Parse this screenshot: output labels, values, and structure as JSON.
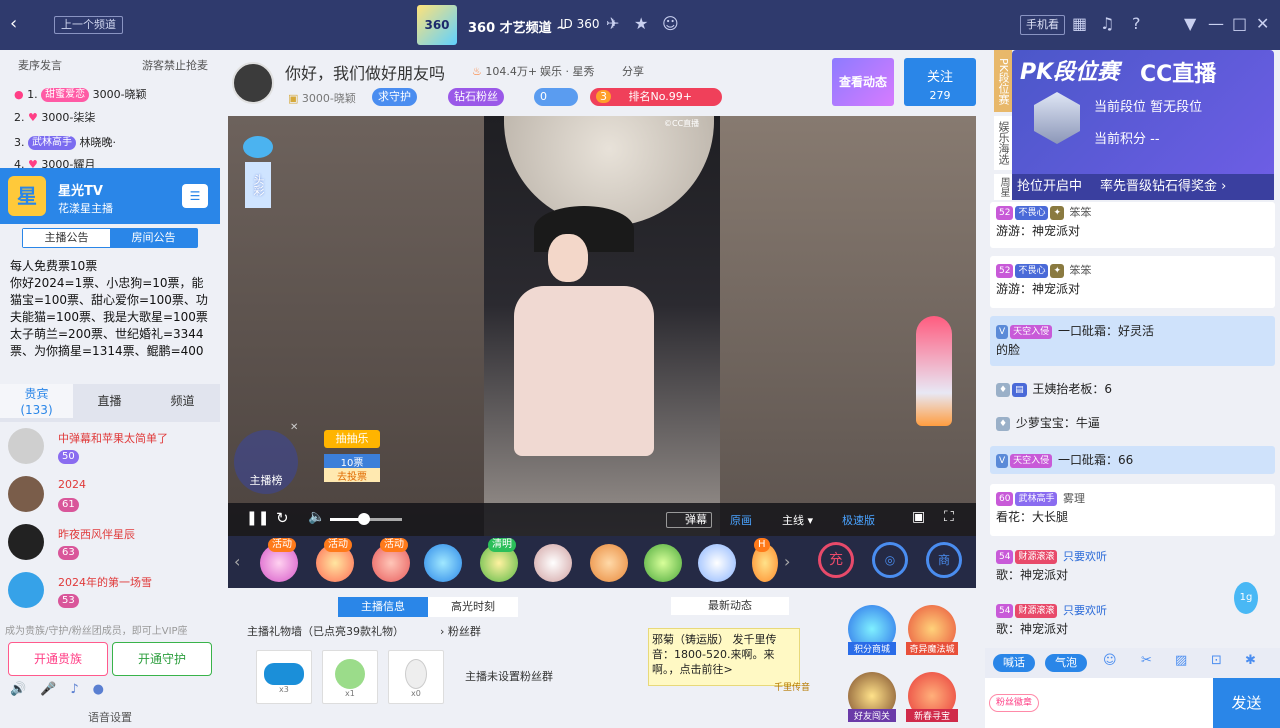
{
  "topbar": {
    "prev_channel": "上一个频道",
    "logo_text": "360",
    "channel_name": "360 才艺频道 ~",
    "channel_id": "ID 360",
    "mobile_watch": "手机看"
  },
  "left": {
    "tabs": {
      "mic_order": "麦序发言",
      "guest_ban": "游客禁止抢麦"
    },
    "rank": [
      {
        "num": "1.",
        "badge": "甜蜜爱恋",
        "name": "3000-晓颖"
      },
      {
        "num": "2.",
        "badge": "",
        "name": "3000-柒柒"
      },
      {
        "num": "3.",
        "badge": "武林高手",
        "name": "林晓晚·"
      },
      {
        "num": "4.",
        "badge": "",
        "name": "3000-耀月"
      }
    ],
    "host_channel": {
      "avatar_text": "星",
      "name": "星光TV",
      "subtitle": "花漾星主播"
    },
    "announce_tabs": {
      "host": "主播公告",
      "room": "房间公告"
    },
    "announcement": "每人免费票10票\n你好2024=1票、小忠狗=10票，能猫宝=100票、甜心爱你=100票、功夫能猫=100票、我是大歌星=100票\n太子萌兰=200票、世纪婚礼=3344票、为你摘星=1314票、鲲鹏=400",
    "vip_tabs": {
      "guests": "贵宾",
      "guests_count": "(133)",
      "live": "直播",
      "channel": "频道"
    },
    "vip_users": [
      {
        "name": "中弹幕和苹果太简单了",
        "level": "50"
      },
      {
        "name": "2024",
        "level": "61"
      },
      {
        "name": "昨夜西风伴星辰",
        "level": "63"
      },
      {
        "name": "2024年的第一场雪",
        "level": "53"
      }
    ],
    "vip_hint": "成为贵族/守护/粉丝团成员，即可上VIP座",
    "open_noble": "开通贵族",
    "open_guard": "开通守护",
    "voice_settings": "语音设置"
  },
  "center": {
    "title": "你好，我们做好朋友吗",
    "popularity": "104.4万+",
    "category": "娱乐 · 星秀",
    "share": "分享",
    "host_name": "3000-晓颖",
    "guard": "求守护",
    "diamond_fans": "钻石粉丝",
    "fans_count": "0",
    "rank_level": "3",
    "rank": "排名No.99+",
    "view_dynamics": "查看动态",
    "follow": "关注",
    "follow_count": "279",
    "video_badge": "头彩",
    "host_list": "主播榜",
    "lottery": "抽抽乐",
    "ticket": "10票",
    "ticket_cta": "去投票",
    "watermark": "©CC直播",
    "danmaku": "弹幕",
    "quality": "原画",
    "line": "主线",
    "more": "极速版",
    "gift_labels": [
      "活动",
      "活动",
      "活动",
      "",
      "清明",
      "",
      "",
      "",
      "",
      "H"
    ],
    "info_tabs": {
      "info": "主播信息",
      "highlight": "高光时刻"
    },
    "gift_wall": "主播礼物墙（已点亮39款礼物）",
    "fan_group": "粉丝群",
    "gift_counts": [
      "x3",
      "x1",
      "x0"
    ],
    "no_fan_group": "主播未设置粉丝群",
    "latest": "最新动态",
    "note": "邪菊（铸运版） 发千里传音：1800-520.来啊。来啊。，点击前往>",
    "note_tag": "千里传音",
    "side_icons": [
      "积分商城",
      "奇异魔法城",
      "好友闯关",
      "新春寻宝"
    ]
  },
  "right": {
    "side_labels": [
      "PK段位赛",
      "娱乐海选",
      "周星"
    ],
    "pk": {
      "title": "PK段位赛",
      "brand": "CC直播",
      "rank": "当前段位 暂无段位",
      "points": "当前积分 --",
      "open": "抢位开启中",
      "prize": "率先晋级钻石得奖金"
    },
    "messages": [
      {
        "lvl": "52",
        "tag": "不畏心",
        "name": "笨笨",
        "text": "游游：神宠派对",
        "blue": false
      },
      {
        "lvl": "52",
        "tag": "不畏心",
        "name": "笨笨",
        "text": "游游：神宠派对",
        "blue": false
      },
      {
        "lvl": "",
        "tag": "天空入侵",
        "name": "一口砒霜：好灵活",
        "text": "的脸",
        "blue": true
      },
      {
        "lvl": "",
        "tag": "",
        "name": "王姨抬老板：6",
        "text": "",
        "blue": false
      },
      {
        "lvl": "",
        "tag": "",
        "name": "少萝宝宝：牛逼",
        "text": "",
        "blue": false
      },
      {
        "lvl": "",
        "tag": "天空入侵",
        "name": "一口砒霜：66",
        "text": "",
        "blue": true
      },
      {
        "lvl": "60",
        "tag": "武林高手",
        "name": "雾理",
        "text": "看花：大长腿",
        "blue": false
      },
      {
        "lvl": "54",
        "tag": "财源滚滚",
        "name": "只要欢听",
        "text": "歌：神宠派对",
        "blue": false
      },
      {
        "lvl": "54",
        "tag": "财源滚滚",
        "name": "只要欢听",
        "text": "歌：神宠派对",
        "blue": false
      }
    ],
    "float_badge": "1g",
    "input_tabs": {
      "shout": "喊话",
      "bubble": "气泡"
    },
    "fan_badge": "粉丝徽章",
    "send": "发送"
  },
  "colors": {
    "topbar": "#2f3a6d",
    "accent": "#2a86e8",
    "pink": "#ff3f86"
  }
}
